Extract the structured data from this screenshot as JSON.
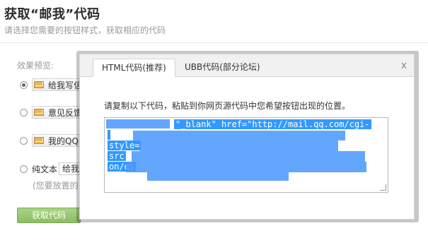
{
  "header": {
    "title": "获取“邮我”代码",
    "subtitle": "请选择您需要的按钮样式，获取相应的代码"
  },
  "preview": {
    "label": "效果预览:",
    "options": [
      {
        "label": "给我写信"
      },
      {
        "label": "意见反馈"
      },
      {
        "label": "我的QQ"
      },
      {
        "label": "纯文本",
        "box_text": "给我写"
      }
    ],
    "note": "(您要放置的"
  },
  "get_code_button": "获取代码",
  "modal": {
    "tabs": [
      "HTML代码(推荐)",
      "UBB代码(部分论坛)"
    ],
    "close": "x",
    "instruction": "请复制以下代码，粘贴到你网页源代码中您希望按钮出现的位置。",
    "code_lines": [
      "\"_blank\" href=\"http://mail.qq.com/cgi-",
      "",
      "style=",
      "src",
      "on/qi"
    ]
  }
}
